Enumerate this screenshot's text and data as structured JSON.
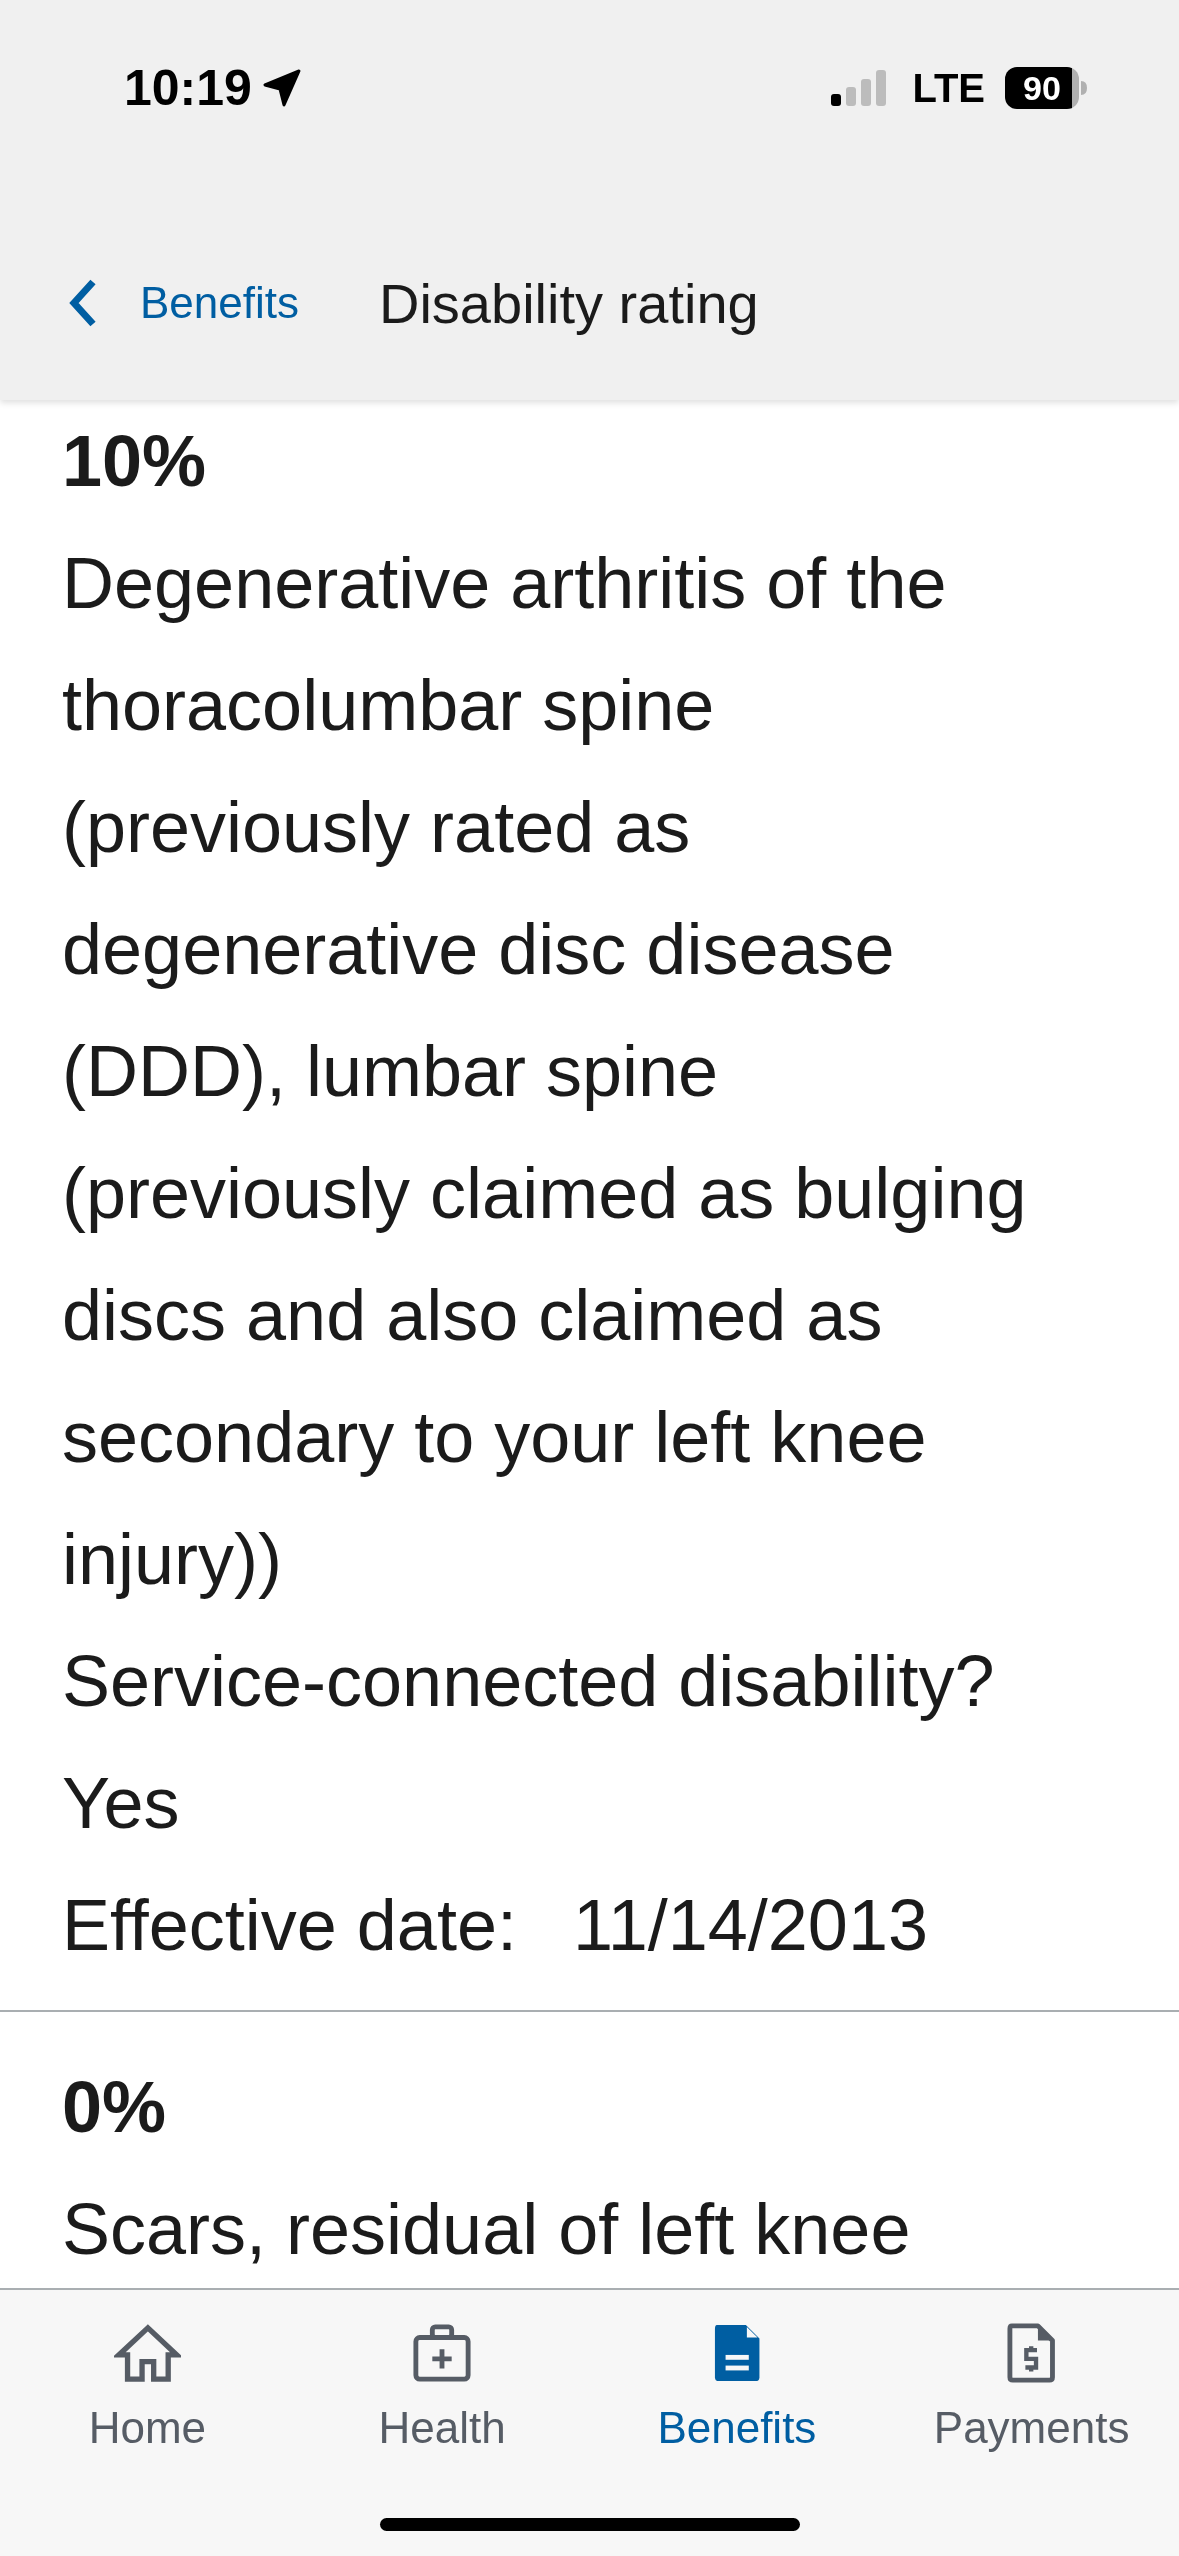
{
  "status_bar": {
    "time": "10:19",
    "network": "LTE",
    "battery": "90"
  },
  "nav_bar": {
    "back_label": "Benefits",
    "title": "Disability rating"
  },
  "ratings": [
    {
      "percent": "10%",
      "description": "Degenerative arthritis of the\nthoracolumbar spine\n(previously rated as\ndegenerative disc disease\n(DDD), lumbar spine\n(previously claimed as bulging\ndiscs and also claimed as\nsecondary to your left knee\ninjury))",
      "service_connected_label": "Service-connected disability?",
      "service_connected_value": "Yes",
      "effective_date_label": "Effective date:",
      "effective_date_value": "11/14/2013"
    },
    {
      "percent": "0%",
      "description": "Scars, residual of left knee"
    }
  ],
  "tabs": [
    {
      "label": "Home",
      "kind": "home",
      "selected": false
    },
    {
      "label": "Health",
      "kind": "health",
      "selected": false
    },
    {
      "label": "Benefits",
      "kind": "benefits",
      "selected": true
    },
    {
      "label": "Payments",
      "kind": "payments",
      "selected": false
    }
  ]
}
